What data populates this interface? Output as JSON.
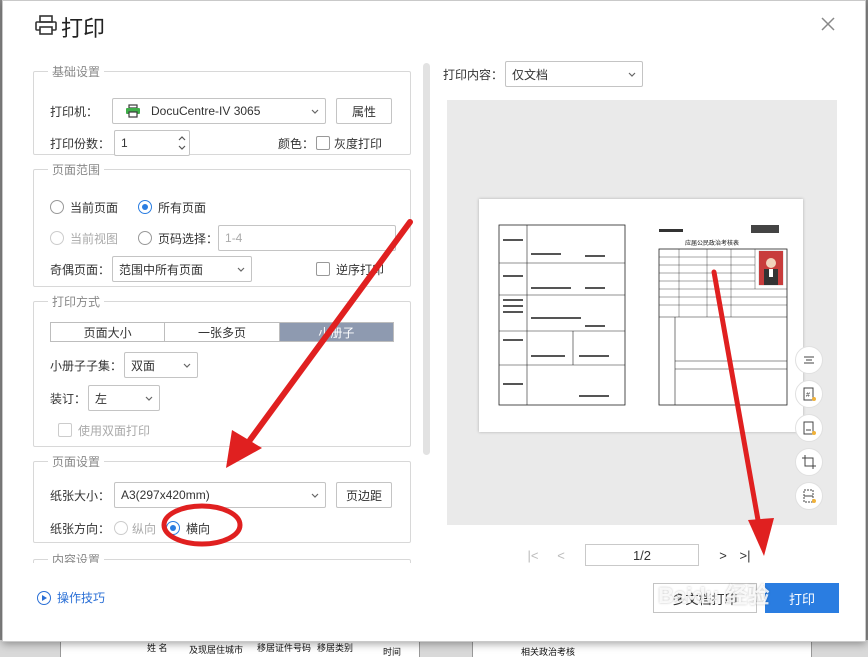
{
  "dialog": {
    "title": "打印",
    "icons": {
      "title": "printer-icon",
      "close": "close-icon"
    }
  },
  "basic": {
    "legend": "基础设置",
    "printer_label": "打印机：",
    "printer_value": "DocuCentre-IV 3065",
    "properties_button": "属性",
    "copies_label": "打印份数：",
    "copies_value": "1",
    "color_label": "颜色：",
    "grayscale_label": "灰度打印"
  },
  "range": {
    "legend": "页面范围",
    "current_page": "当前页面",
    "all_pages": "所有页面",
    "current_view": "当前视图",
    "page_select": "页码选择：",
    "page_select_placeholder": "1-4",
    "odd_even_label": "奇偶页面：",
    "odd_even_value": "范围中所有页面",
    "reverse_label": "逆序打印"
  },
  "method": {
    "legend": "打印方式",
    "tabs": [
      "页面大小",
      "一张多页",
      "小册子"
    ],
    "booklet_subset_label": "小册子子集：",
    "booklet_subset_value": "双面",
    "binding_label": "装订：",
    "binding_value": "左",
    "duplex_label": "使用双面打印"
  },
  "page_setup": {
    "legend": "页面设置",
    "paper_size_label": "纸张大小：",
    "paper_size_value": "A3(297x420mm)",
    "margins_button": "页边距",
    "orientation_label": "纸张方向：",
    "portrait": "纵向",
    "landscape": "横向"
  },
  "content": {
    "legend": "内容设置"
  },
  "tips_label": "操作技巧",
  "preview": {
    "content_label": "打印内容：",
    "content_value": "仅文档",
    "page_indicator": "1/2",
    "doc_title": "应届公民政治考核表"
  },
  "actions": {
    "multi_doc_print": "多文档打印",
    "print": "打印"
  },
  "background_doc": {
    "cells": [
      "姓 名",
      "及现居住城市",
      "移居证件号码",
      "移居类别",
      "时间",
      "相关政治考核"
    ]
  },
  "watermark": {
    "brand": "Baidu 经验",
    "url": "jingyan.baidu.com"
  },
  "colors": {
    "accent": "#2a7de1",
    "annotation": "#e02020"
  }
}
